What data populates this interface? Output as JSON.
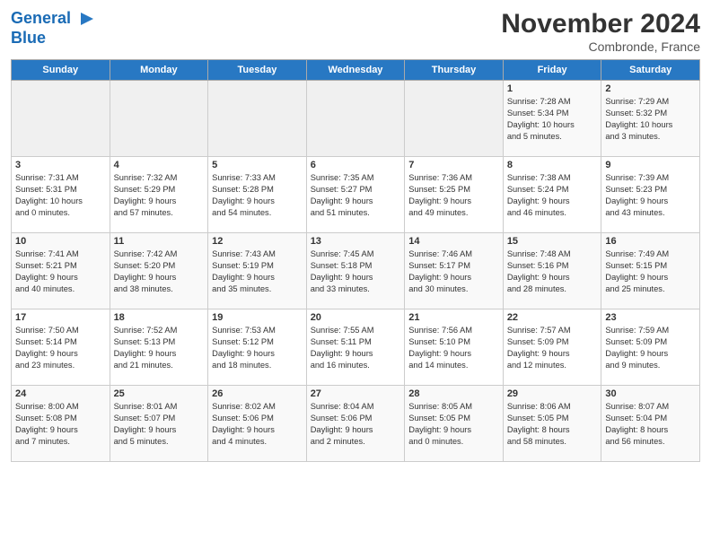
{
  "header": {
    "logo_line1": "General",
    "logo_line2": "Blue",
    "month": "November 2024",
    "location": "Combronde, France"
  },
  "days_of_week": [
    "Sunday",
    "Monday",
    "Tuesday",
    "Wednesday",
    "Thursday",
    "Friday",
    "Saturday"
  ],
  "weeks": [
    [
      {
        "day": "",
        "info": ""
      },
      {
        "day": "",
        "info": ""
      },
      {
        "day": "",
        "info": ""
      },
      {
        "day": "",
        "info": ""
      },
      {
        "day": "",
        "info": ""
      },
      {
        "day": "1",
        "info": "Sunrise: 7:28 AM\nSunset: 5:34 PM\nDaylight: 10 hours\nand 5 minutes."
      },
      {
        "day": "2",
        "info": "Sunrise: 7:29 AM\nSunset: 5:32 PM\nDaylight: 10 hours\nand 3 minutes."
      }
    ],
    [
      {
        "day": "3",
        "info": "Sunrise: 7:31 AM\nSunset: 5:31 PM\nDaylight: 10 hours\nand 0 minutes."
      },
      {
        "day": "4",
        "info": "Sunrise: 7:32 AM\nSunset: 5:29 PM\nDaylight: 9 hours\nand 57 minutes."
      },
      {
        "day": "5",
        "info": "Sunrise: 7:33 AM\nSunset: 5:28 PM\nDaylight: 9 hours\nand 54 minutes."
      },
      {
        "day": "6",
        "info": "Sunrise: 7:35 AM\nSunset: 5:27 PM\nDaylight: 9 hours\nand 51 minutes."
      },
      {
        "day": "7",
        "info": "Sunrise: 7:36 AM\nSunset: 5:25 PM\nDaylight: 9 hours\nand 49 minutes."
      },
      {
        "day": "8",
        "info": "Sunrise: 7:38 AM\nSunset: 5:24 PM\nDaylight: 9 hours\nand 46 minutes."
      },
      {
        "day": "9",
        "info": "Sunrise: 7:39 AM\nSunset: 5:23 PM\nDaylight: 9 hours\nand 43 minutes."
      }
    ],
    [
      {
        "day": "10",
        "info": "Sunrise: 7:41 AM\nSunset: 5:21 PM\nDaylight: 9 hours\nand 40 minutes."
      },
      {
        "day": "11",
        "info": "Sunrise: 7:42 AM\nSunset: 5:20 PM\nDaylight: 9 hours\nand 38 minutes."
      },
      {
        "day": "12",
        "info": "Sunrise: 7:43 AM\nSunset: 5:19 PM\nDaylight: 9 hours\nand 35 minutes."
      },
      {
        "day": "13",
        "info": "Sunrise: 7:45 AM\nSunset: 5:18 PM\nDaylight: 9 hours\nand 33 minutes."
      },
      {
        "day": "14",
        "info": "Sunrise: 7:46 AM\nSunset: 5:17 PM\nDaylight: 9 hours\nand 30 minutes."
      },
      {
        "day": "15",
        "info": "Sunrise: 7:48 AM\nSunset: 5:16 PM\nDaylight: 9 hours\nand 28 minutes."
      },
      {
        "day": "16",
        "info": "Sunrise: 7:49 AM\nSunset: 5:15 PM\nDaylight: 9 hours\nand 25 minutes."
      }
    ],
    [
      {
        "day": "17",
        "info": "Sunrise: 7:50 AM\nSunset: 5:14 PM\nDaylight: 9 hours\nand 23 minutes."
      },
      {
        "day": "18",
        "info": "Sunrise: 7:52 AM\nSunset: 5:13 PM\nDaylight: 9 hours\nand 21 minutes."
      },
      {
        "day": "19",
        "info": "Sunrise: 7:53 AM\nSunset: 5:12 PM\nDaylight: 9 hours\nand 18 minutes."
      },
      {
        "day": "20",
        "info": "Sunrise: 7:55 AM\nSunset: 5:11 PM\nDaylight: 9 hours\nand 16 minutes."
      },
      {
        "day": "21",
        "info": "Sunrise: 7:56 AM\nSunset: 5:10 PM\nDaylight: 9 hours\nand 14 minutes."
      },
      {
        "day": "22",
        "info": "Sunrise: 7:57 AM\nSunset: 5:09 PM\nDaylight: 9 hours\nand 12 minutes."
      },
      {
        "day": "23",
        "info": "Sunrise: 7:59 AM\nSunset: 5:09 PM\nDaylight: 9 hours\nand 9 minutes."
      }
    ],
    [
      {
        "day": "24",
        "info": "Sunrise: 8:00 AM\nSunset: 5:08 PM\nDaylight: 9 hours\nand 7 minutes."
      },
      {
        "day": "25",
        "info": "Sunrise: 8:01 AM\nSunset: 5:07 PM\nDaylight: 9 hours\nand 5 minutes."
      },
      {
        "day": "26",
        "info": "Sunrise: 8:02 AM\nSunset: 5:06 PM\nDaylight: 9 hours\nand 4 minutes."
      },
      {
        "day": "27",
        "info": "Sunrise: 8:04 AM\nSunset: 5:06 PM\nDaylight: 9 hours\nand 2 minutes."
      },
      {
        "day": "28",
        "info": "Sunrise: 8:05 AM\nSunset: 5:05 PM\nDaylight: 9 hours\nand 0 minutes."
      },
      {
        "day": "29",
        "info": "Sunrise: 8:06 AM\nSunset: 5:05 PM\nDaylight: 8 hours\nand 58 minutes."
      },
      {
        "day": "30",
        "info": "Sunrise: 8:07 AM\nSunset: 5:04 PM\nDaylight: 8 hours\nand 56 minutes."
      }
    ]
  ]
}
